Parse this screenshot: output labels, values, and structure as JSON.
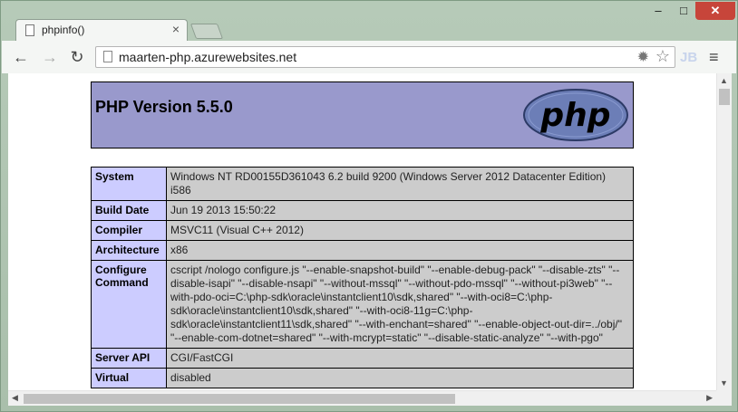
{
  "browser": {
    "tab_title": "phpinfo()",
    "tab_close": "×",
    "window_buttons": {
      "minimize": "–",
      "maximize": "□",
      "close": "✕"
    },
    "url": "maarten-php.azurewebsites.net",
    "extension_label": "JB",
    "nav": {
      "back": "←",
      "forward": "→",
      "reload": "↻",
      "menu": "≡"
    },
    "icons": {
      "settings": "✹",
      "bookmark": "☆"
    }
  },
  "php": {
    "version_title": "PHP Version 5.5.0",
    "logo_text": "php",
    "rows": [
      {
        "key": "System",
        "value": "Windows NT RD00155D361043 6.2 build 9200 (Windows Server 2012 Datacenter Edition) i586"
      },
      {
        "key": "Build Date",
        "value": "Jun 19 2013 15:50:22"
      },
      {
        "key": "Compiler",
        "value": "MSVC11 (Visual C++ 2012)"
      },
      {
        "key": "Architecture",
        "value": "x86"
      },
      {
        "key": "Configure Command",
        "value": "cscript /nologo configure.js \"--enable-snapshot-build\" \"--enable-debug-pack\" \"--disable-zts\" \"--disable-isapi\" \"--disable-nsapi\" \"--without-mssql\" \"--without-pdo-mssql\" \"--without-pi3web\" \"--with-pdo-oci=C:\\php-sdk\\oracle\\instantclient10\\sdk,shared\" \"--with-oci8=C:\\php-sdk\\oracle\\instantclient10\\sdk,shared\" \"--with-oci8-11g=C:\\php-sdk\\oracle\\instantclient11\\sdk,shared\" \"--with-enchant=shared\" \"--enable-object-out-dir=../obj/\" \"--enable-com-dotnet=shared\" \"--with-mcrypt=static\" \"--disable-static-analyze\" \"--with-pgo\""
      },
      {
        "key": "Server API",
        "value": "CGI/FastCGI"
      },
      {
        "key": "Virtual",
        "value": "disabled"
      }
    ]
  },
  "colors": {
    "header_bg": "#9999cc",
    "key_bg": "#ccccff",
    "value_bg": "#cccccc",
    "window_frame": "#b6cab8",
    "close_button": "#c7453a"
  }
}
